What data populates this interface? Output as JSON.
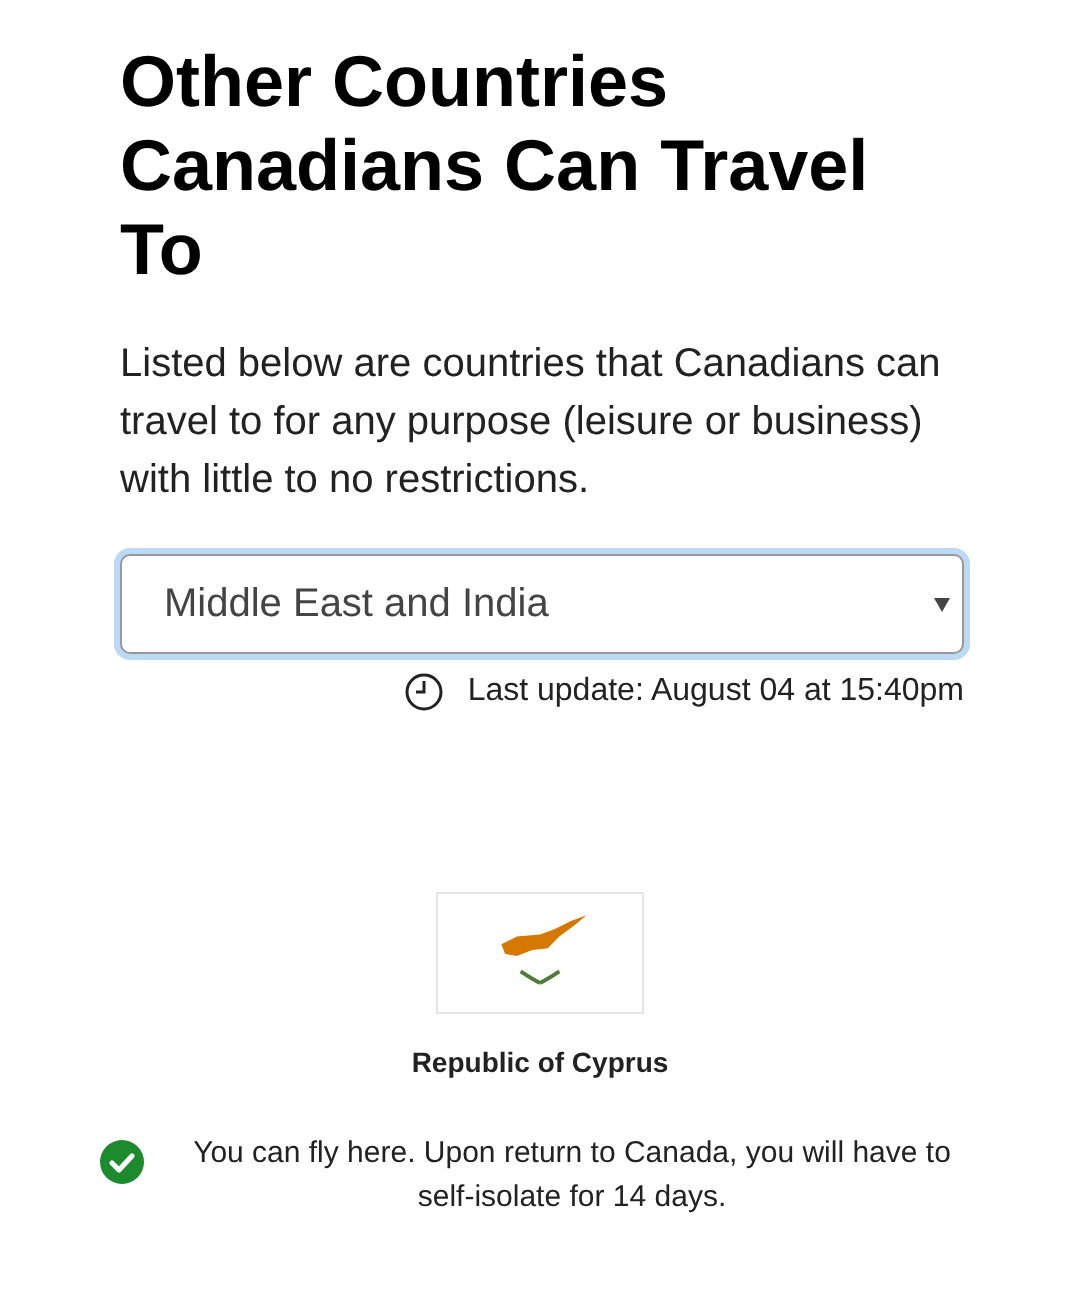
{
  "heading": "Other Countries Canadians Can Travel To",
  "intro": "Listed below are countries that Canadians can travel to for any purpose (leisure or business) with little to no restrictions.",
  "region_select": {
    "value": "Middle East and India",
    "focused": true
  },
  "last_update": "Last update: August 04 at 15:40pm",
  "countries": [
    {
      "name": "Republic of Cyprus",
      "status": {
        "kind": "allowed",
        "text": "You can fly here. Upon return to Canada, you will have to self-isolate for 14 days."
      }
    }
  ]
}
